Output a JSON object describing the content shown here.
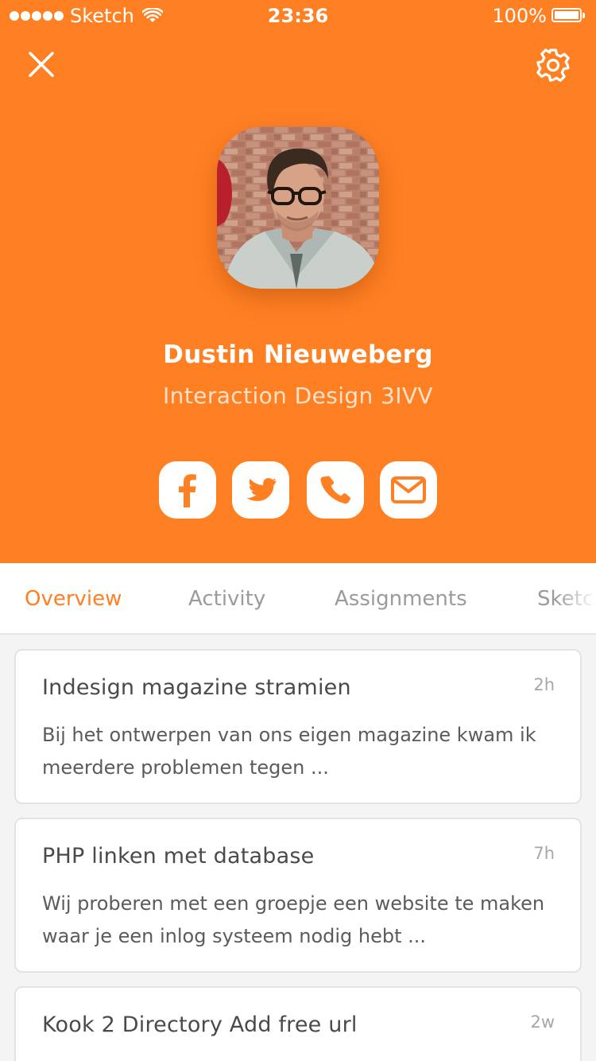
{
  "status_bar": {
    "carrier": "Sketch",
    "time": "23:36",
    "battery": "100%"
  },
  "header": {
    "close_icon": "close-icon",
    "settings_icon": "gear-icon",
    "background_color": "#ff7f23"
  },
  "profile": {
    "name": "Dustin Nieuweberg",
    "course": "Interaction Design 3IVV",
    "avatar": "profile-photo"
  },
  "social": [
    {
      "name": "facebook",
      "icon": "facebook-icon"
    },
    {
      "name": "twitter",
      "icon": "twitter-icon"
    },
    {
      "name": "phone",
      "icon": "phone-icon"
    },
    {
      "name": "email",
      "icon": "mail-icon"
    }
  ],
  "tabs": [
    {
      "label": "Overview",
      "active": true
    },
    {
      "label": "Activity",
      "active": false
    },
    {
      "label": "Assignments",
      "active": false
    },
    {
      "label": "Sketch",
      "active": false
    }
  ],
  "posts": [
    {
      "title": "Indesign magazine stramien",
      "time": "2h",
      "body": "Bij het ontwerpen van ons eigen magazine kwam ik meerdere problemen tegen ..."
    },
    {
      "title": "PHP linken met database",
      "time": "7h",
      "body": "Wij proberen met een groepje een website te maken waar je een inlog systeem nodig hebt ..."
    },
    {
      "title": "Kook 2 Directory Add free url",
      "time": "2w",
      "body": ""
    }
  ],
  "colors": {
    "accent": "#ff7f23",
    "inactive_tab": "#9b9b9b",
    "card_title": "#4a4a4a",
    "card_body": "#5b5b5b",
    "page_bg": "#f4f4f4"
  }
}
